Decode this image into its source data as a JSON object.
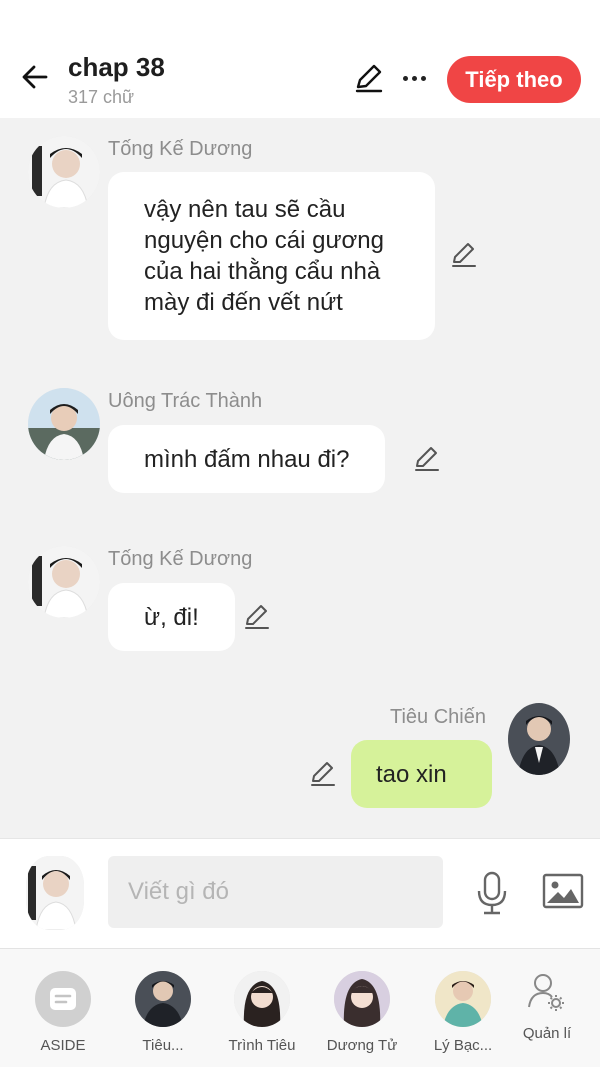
{
  "header": {
    "title": "chap 38",
    "subtitle": "317 chữ",
    "next_label": "Tiếp theo"
  },
  "messages": [
    {
      "name": "Tống Kế Dương",
      "text_lines": [
        "vậy nên tau sẽ cầu",
        "nguyện cho cái gương",
        "của hai thằng cẩu nhà",
        "mày đi đến vết nứt"
      ]
    },
    {
      "name": "Uông Trác Thành",
      "text": "mình đấm nhau đi?"
    },
    {
      "name": "Tống Kế Dương",
      "text": "ừ, đi!"
    },
    {
      "name": "Tiêu Chiến",
      "text": "tao xin"
    }
  ],
  "composer": {
    "placeholder": "Viết gì đó"
  },
  "bottom_bar": {
    "items": [
      {
        "label": "ASIDE"
      },
      {
        "label": "Tiêu..."
      },
      {
        "label": "Trình Tiêu"
      },
      {
        "label": "Dương Tử"
      },
      {
        "label": "Lý Bạc..."
      },
      {
        "label": "Quản lí"
      }
    ]
  },
  "colors": {
    "accent": "#f04545",
    "my_bubble": "#d6f29a",
    "other_bubble": "#ffffff",
    "background": "#f2f2f2"
  }
}
